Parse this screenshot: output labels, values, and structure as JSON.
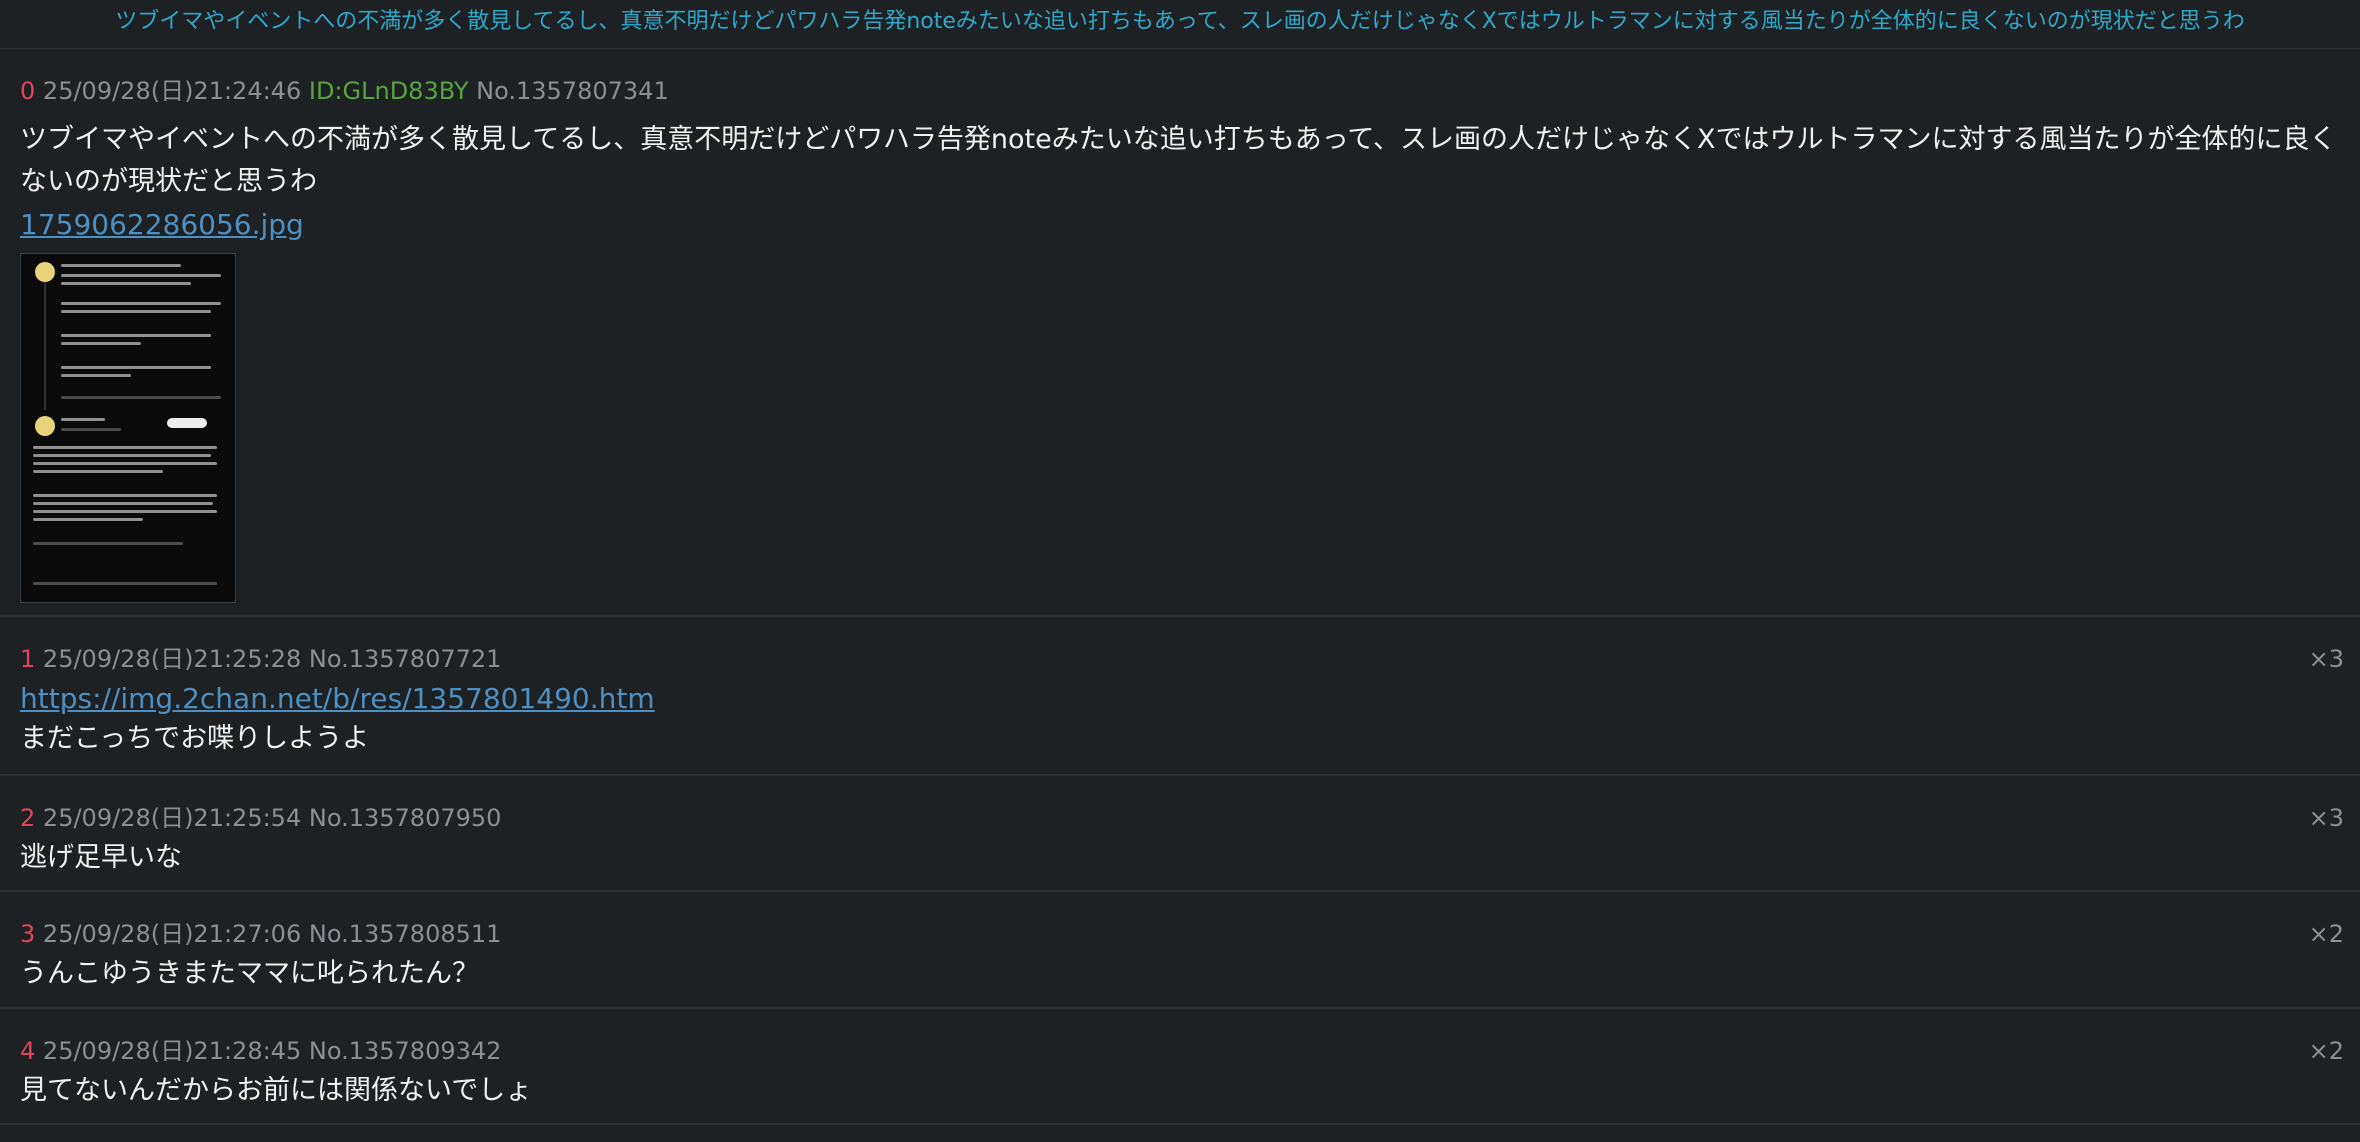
{
  "thread": {
    "title": "ツブイマやイベントへの不満が多く散見してるし、真意不明だけどパワハラ告発noteみたいな追い打ちもあって、スレ画の人だけじゃなくXではウルトラマンに対する風当たりが全体的に良くないのが現状だと思うわ"
  },
  "posts": [
    {
      "num": "0",
      "date": "25/09/28(日)21:24:46",
      "id": "ID:GLnD83BY",
      "no": "No.1357807341",
      "body": "ツブイマやイベントへの不満が多く散見してるし、真意不明だけどパワハラ告発noteみたいな追い打ちもあって、スレ画の人だけじゃなくXではウルトラマンに対する風当たりが全体的に良くないのが現状だと思うわ",
      "file": "1759062286056.jpg"
    },
    {
      "num": "1",
      "date": "25/09/28(日)21:25:28",
      "no": "No.1357807721",
      "count": "×3",
      "link": "https://img.2chan.net/b/res/1357801490.htm",
      "body": "まだこっちでお喋りしようよ"
    },
    {
      "num": "2",
      "date": "25/09/28(日)21:25:54",
      "no": "No.1357807950",
      "count": "×3",
      "body": "逃げ足早いな"
    },
    {
      "num": "3",
      "date": "25/09/28(日)21:27:06",
      "no": "No.1357808511",
      "count": "×2",
      "body": "うんこゆうきまたママに叱られたん？"
    },
    {
      "num": "4",
      "date": "25/09/28(日)21:28:45",
      "no": "No.1357809342",
      "count": "×2",
      "body": "見てないんだからお前には関係ないでしょ"
    }
  ],
  "colors": {
    "background": "#1e2124",
    "title": "#2fa7c9",
    "post_number": "#e0455a",
    "poster_id": "#56a53e",
    "link": "#4d8fc0",
    "meta": "#8a8f94"
  }
}
